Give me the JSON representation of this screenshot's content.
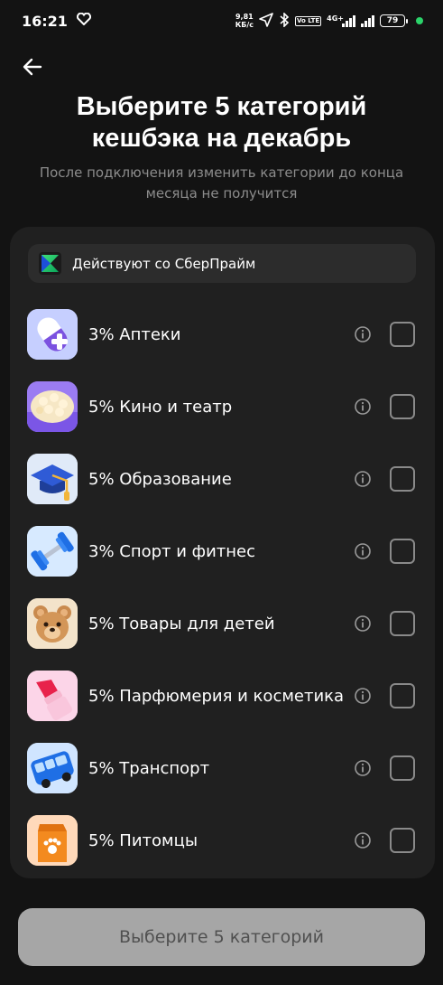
{
  "status_bar": {
    "time": "16:21",
    "net_speed_value": "9,81",
    "net_speed_unit": "КБ/с",
    "volte": "Vo LTE",
    "network": "4G+",
    "battery": "79"
  },
  "header": {
    "title": "Выберите 5 категорий кешбэка на декабрь",
    "subtitle": "После подключения изменить категории до конца месяца не получится"
  },
  "prime_banner": {
    "label": "Действуют со СберПрайм"
  },
  "categories": [
    {
      "label": "3% Аптеки",
      "icon": "pill-icon",
      "color": "#c9d2ff"
    },
    {
      "label": "5% Кино и театр",
      "icon": "popcorn-icon",
      "color": "#9a7bf0"
    },
    {
      "label": "5% Образование",
      "icon": "graduation-cap-icon",
      "color": "#dfe9f7"
    },
    {
      "label": "3% Спорт и фитнес",
      "icon": "dumbbell-icon",
      "color": "#d6e9ff"
    },
    {
      "label": "5% Товары для детей",
      "icon": "teddy-bear-icon",
      "color": "#f2e2c8"
    },
    {
      "label": "5% Парфюмерия и косметика",
      "icon": "lipstick-icon",
      "color": "#fbd3e6"
    },
    {
      "label": "5% Транспорт",
      "icon": "bus-icon",
      "color": "#cfe4ff"
    },
    {
      "label": "5% Питомцы",
      "icon": "pet-food-bag-icon",
      "color": "#ffd8b8"
    }
  ],
  "footer": {
    "submit_label": "Выберите 5 категорий"
  },
  "colors": {
    "background": "#131313",
    "card": "#202020",
    "banner": "#2c2c2c",
    "button_disabled": "#a6a6a6",
    "accent_green": "#21a038"
  }
}
